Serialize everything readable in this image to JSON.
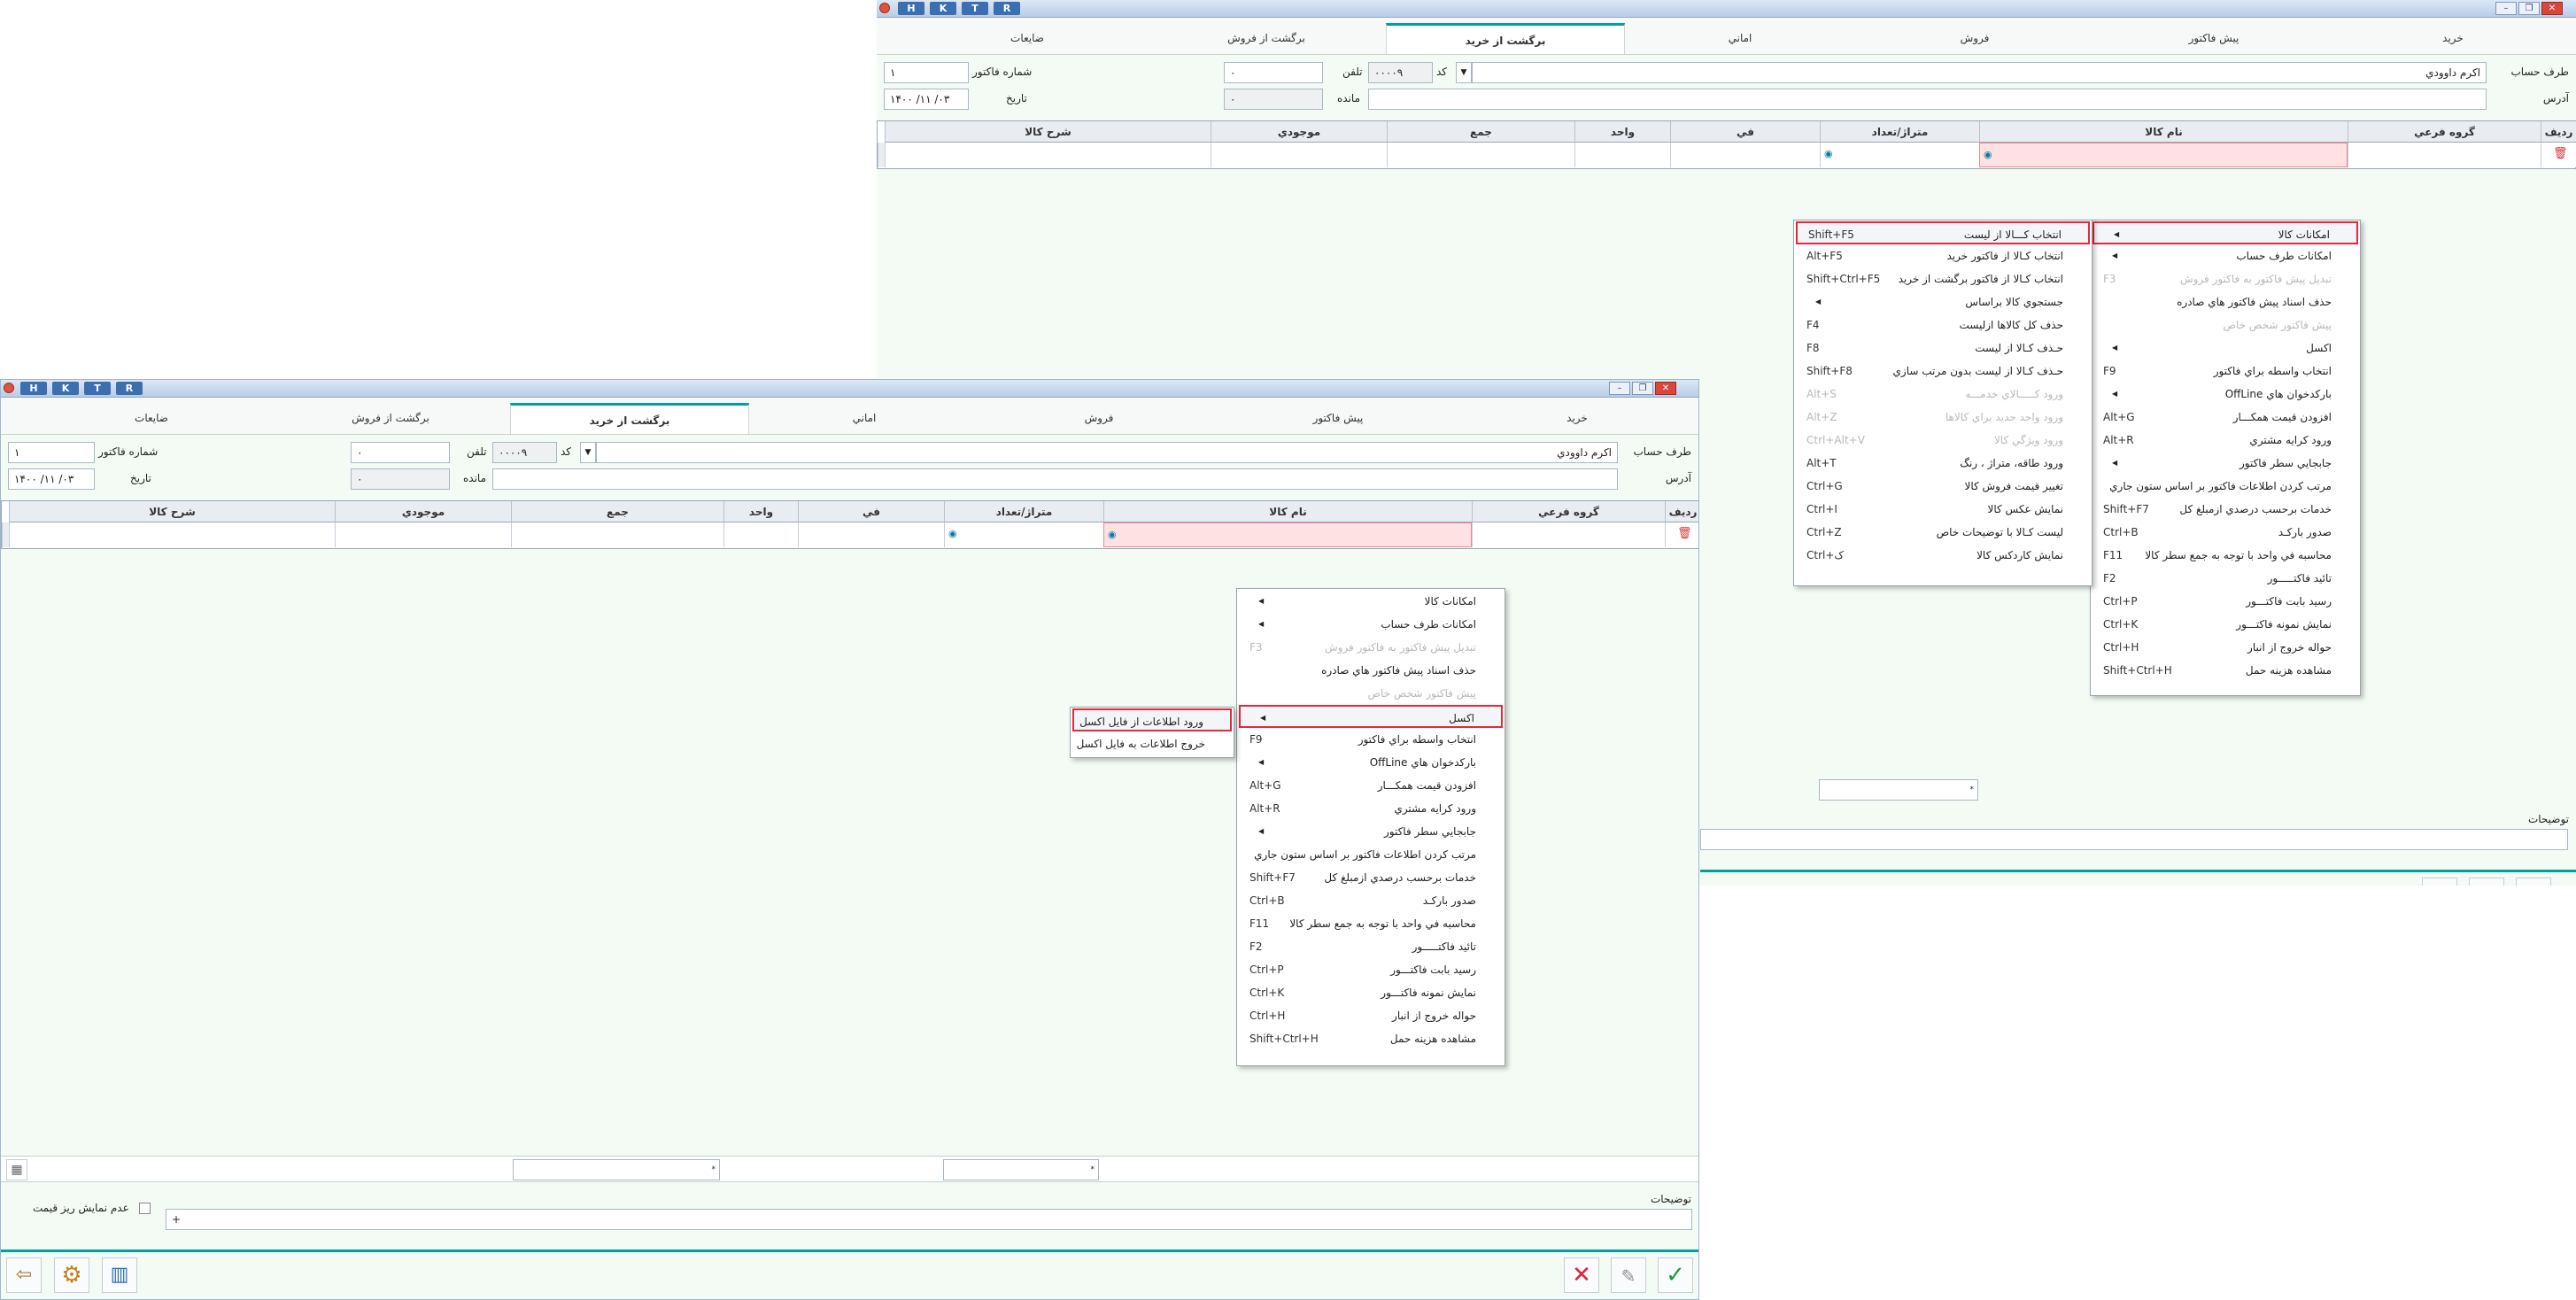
{
  "titlebar": {
    "buttons": [
      "H",
      "K",
      "T",
      "R"
    ]
  },
  "tabs": [
    "خريد",
    "پيش فاکتور",
    "فروش",
    "اماني",
    "برگشت از خريد",
    "برگشت از فروش",
    "ضايعات"
  ],
  "active_tab": "برگشت از خريد",
  "form": {
    "account_label": "طرف حساب",
    "account_value": "اکرم داوودي",
    "code_label": "کد",
    "code_value": "۰۰۰۰۹",
    "phone_label": "تلفن",
    "phone_value": "۰",
    "invoice_no_label": "شماره فاکتور",
    "invoice_no_value": "۱",
    "address_label": "آدرس",
    "remain_label": "مانده",
    "remain_value": "۰",
    "date_label": "تاريخ",
    "date_value": "۱۴۰۰ /۱۱ /۰۳"
  },
  "grid": {
    "headers": [
      "رديف",
      "گروه فرعي",
      "نام کالا",
      "متراژ/تعداد",
      "في",
      "واحد",
      "جمع",
      "موجودي",
      "شرح کالا"
    ]
  },
  "main_menu": [
    {
      "label": "امکانات کالا",
      "submenu": true
    },
    {
      "label": "امکانات طرف حساب",
      "submenu": true
    },
    {
      "label": "تبديل پيش فاکتور به فاکتور فروش",
      "shortcut": "F3",
      "disabled": true
    },
    {
      "label": "حذف اسناد پيش فاکتور هاي صادره"
    },
    {
      "label": "پيش فاکتور شخص خاص",
      "disabled": true
    },
    {
      "label": "اکسل",
      "submenu": true
    },
    {
      "label": "انتخاب واسطه براي فاکتور",
      "shortcut": "F9"
    },
    {
      "label": "بارکدخوان هاي OffLine",
      "submenu": true
    },
    {
      "label": "افزودن قيمت همکـــار",
      "shortcut": "Alt+G"
    },
    {
      "label": "ورود کرايه مشتري",
      "shortcut": "Alt+R"
    },
    {
      "label": "جابجايي سطر فاکتور",
      "submenu": true
    },
    {
      "label": "مرتب کردن اطلاعات فاکتور بر اساس ستون جاري"
    },
    {
      "label": "خدمات برحسب درصدي ازمبلغ کل",
      "shortcut": "Shift+F7"
    },
    {
      "label": "صدور بارکـد",
      "shortcut": "Ctrl+B"
    },
    {
      "label": "محاسبه في واحد با توجه به جمع سطر کالا",
      "shortcut": "F11"
    },
    {
      "label": "تائيد فاکتـــــور",
      "shortcut": "F2"
    },
    {
      "label": "رسيد بابت فاکتـــور",
      "shortcut": "Ctrl+P"
    },
    {
      "label": "نمايش نمونه فاکتـــور",
      "shortcut": "Ctrl+K"
    },
    {
      "label": "حواله خروج از انبار",
      "shortcut": "Ctrl+H"
    },
    {
      "label": "مشاهده هزينه حمل",
      "shortcut": "Shift+Ctrl+H"
    }
  ],
  "goods_submenu": [
    {
      "label": "انتخاب کـــالا از ليست",
      "shortcut": "Shift+F5"
    },
    {
      "label": "انتخاب کـالا از فاکتور خريد",
      "shortcut": "Alt+F5"
    },
    {
      "label": "انتخاب کـالا از فاکتور برگشت از خريد",
      "shortcut": "Shift+Ctrl+F5"
    },
    {
      "label": "جستجوي کالا براساس",
      "submenu": true
    },
    {
      "label": "حذف کل کالاها ازليست",
      "shortcut": "F4"
    },
    {
      "label": "حـذف کـالا از ليست",
      "shortcut": "F8"
    },
    {
      "label": "حـذف کـالا از ليست بدون مرتب سازي",
      "shortcut": "Shift+F8"
    },
    {
      "label": "ورود کـــــالاي خدمـــه",
      "shortcut": "Alt+S",
      "disabled": true
    },
    {
      "label": "ورود واحد جديد براي کالاها",
      "shortcut": "Alt+Z",
      "disabled": true
    },
    {
      "label": "ورود ويژگي کالا",
      "shortcut": "Ctrl+Alt+V",
      "disabled": true
    },
    {
      "label": "ورود طاقه، متراژ ، رنگ",
      "shortcut": "Alt+T"
    },
    {
      "label": "تغيير قيمت فروش کالا",
      "shortcut": "Ctrl+G"
    },
    {
      "label": "نمايش عکس کالا",
      "shortcut": "Ctrl+I"
    },
    {
      "label": "ليست کـالا با توضيحات خاص",
      "shortcut": "Ctrl+Z"
    },
    {
      "label": "نمايش کاردکس کالا",
      "shortcut": "Ctrl+ک"
    }
  ],
  "excel_submenu": [
    {
      "label": "ورود اطلاعات از فايل اکسل"
    },
    {
      "label": "خروج اطلاعات به فايل اکسل"
    }
  ],
  "footer": {
    "notes_label": "توضيحات",
    "notes_value": "+",
    "hide_price_label": "عدم نمايش ريز قيمت",
    "combo_placeholder": "*"
  }
}
